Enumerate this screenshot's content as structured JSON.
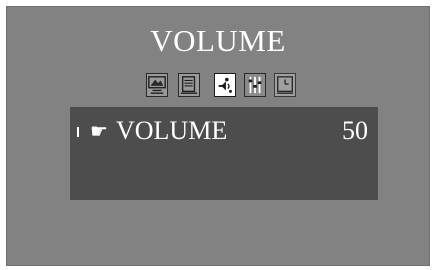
{
  "menu": {
    "title": "VOLUME",
    "icons": [
      "picture-icon",
      "screen-icon",
      "sound-icon",
      "setup-icon",
      "timer-icon"
    ],
    "selected_icon": "sound-icon"
  },
  "item": {
    "label": "VOLUME",
    "value": "50"
  }
}
